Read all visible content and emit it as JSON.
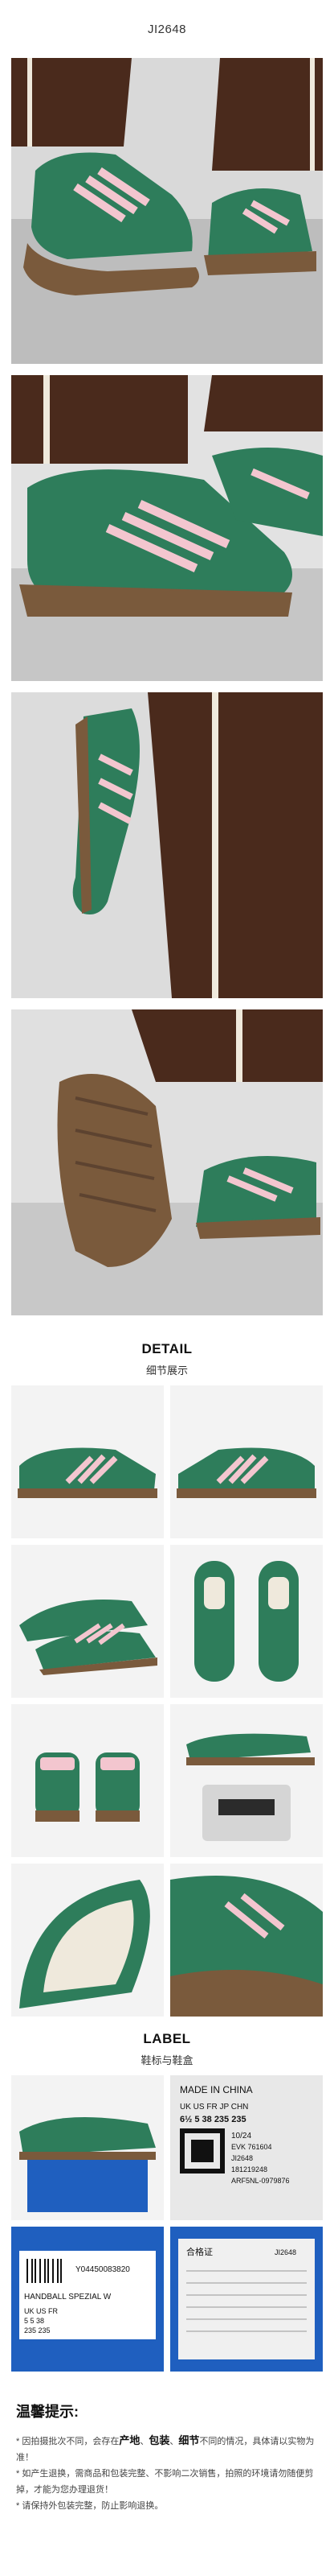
{
  "header": {
    "sku": "JI2648"
  },
  "detail_section": {
    "title_en": "DETAIL",
    "title_cn": "细节展示"
  },
  "label_section": {
    "title_en": "LABEL",
    "title_cn": "鞋标与鞋盒"
  },
  "size_label": {
    "made_in": "MADE IN CHINA",
    "size_headers": "UK  US  FR  JP  CHN",
    "size_values": "6½  5  38  235  235",
    "date": "10/24",
    "code1": "EVK 761604",
    "code2": "JI2648",
    "code3": "181219248",
    "code4": "ARF5NL-0979876"
  },
  "box_label": {
    "barcode_no": "Y04450083820",
    "product": "HANDBALL SPEZIAL W",
    "sizes_top": "UK  US  FR",
    "sizes_mid": "5  5  38",
    "sizes_bot": "235  235"
  },
  "certificate": {
    "code": "JI2648",
    "heading": "合格证"
  },
  "tips": {
    "title": "温馨提示:",
    "line1_a": "* 因拍摄批次不同，会存在",
    "line1_b1": "产地",
    "line1_sep1": "、",
    "line1_b2": "包装",
    "line1_sep2": "、",
    "line1_b3": "细节",
    "line1_c": "不同的情况，具体请以实物为准！",
    "line2": "* 如产生退换，需商品和包装完整、不影响二次销售，拍照的环境请勿随便剪掉，才能为您办理退货！",
    "line3": "* 请保持外包装完整，防止影响退换。"
  },
  "colors": {
    "shoe_green": "#2e7d5b",
    "stripe_pink": "#f3c6cf",
    "sole_gum": "#7a5a3c",
    "pant_brown": "#4a2a1c"
  }
}
